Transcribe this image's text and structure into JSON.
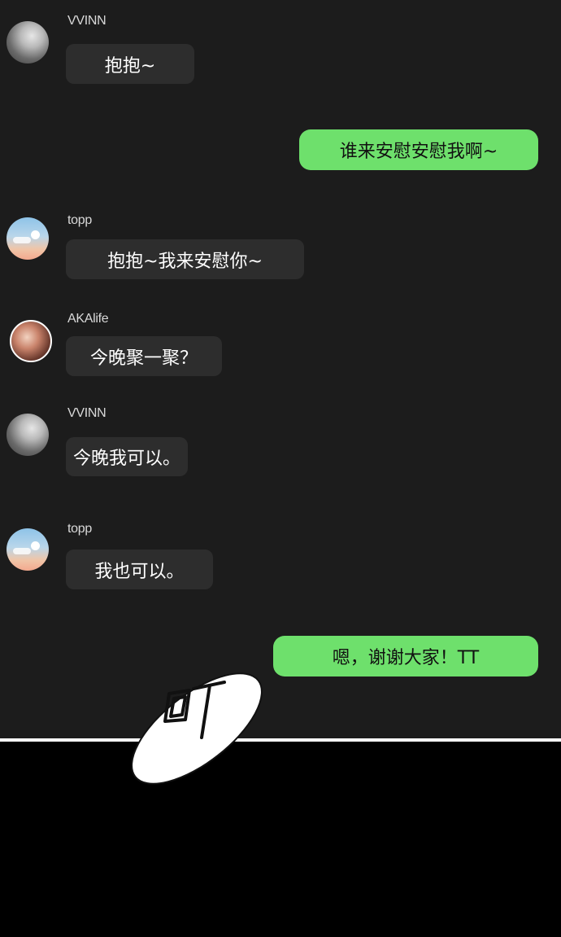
{
  "messages": [
    {
      "sender": "VVINN",
      "text": "抱抱~"
    },
    {
      "sender": "",
      "text": "谁来安慰安慰我啊~"
    },
    {
      "sender": "topp",
      "text": "抱抱~我来安慰你~"
    },
    {
      "sender": "AKAlife",
      "text": "今晚聚一聚？"
    },
    {
      "sender": "VVINN",
      "text": "今晚我可以。"
    },
    {
      "sender": "topp",
      "text": "我也可以。"
    },
    {
      "sender": "",
      "text": "嗯，谢谢大家！TT"
    }
  ],
  "sfx": {
    "text": "OT"
  },
  "colors": {
    "chat_background": "#1c1c1c",
    "incoming_bubble": "#2d2d2d",
    "outgoing_bubble": "#6ee06c",
    "lower_panel": "#000000"
  }
}
